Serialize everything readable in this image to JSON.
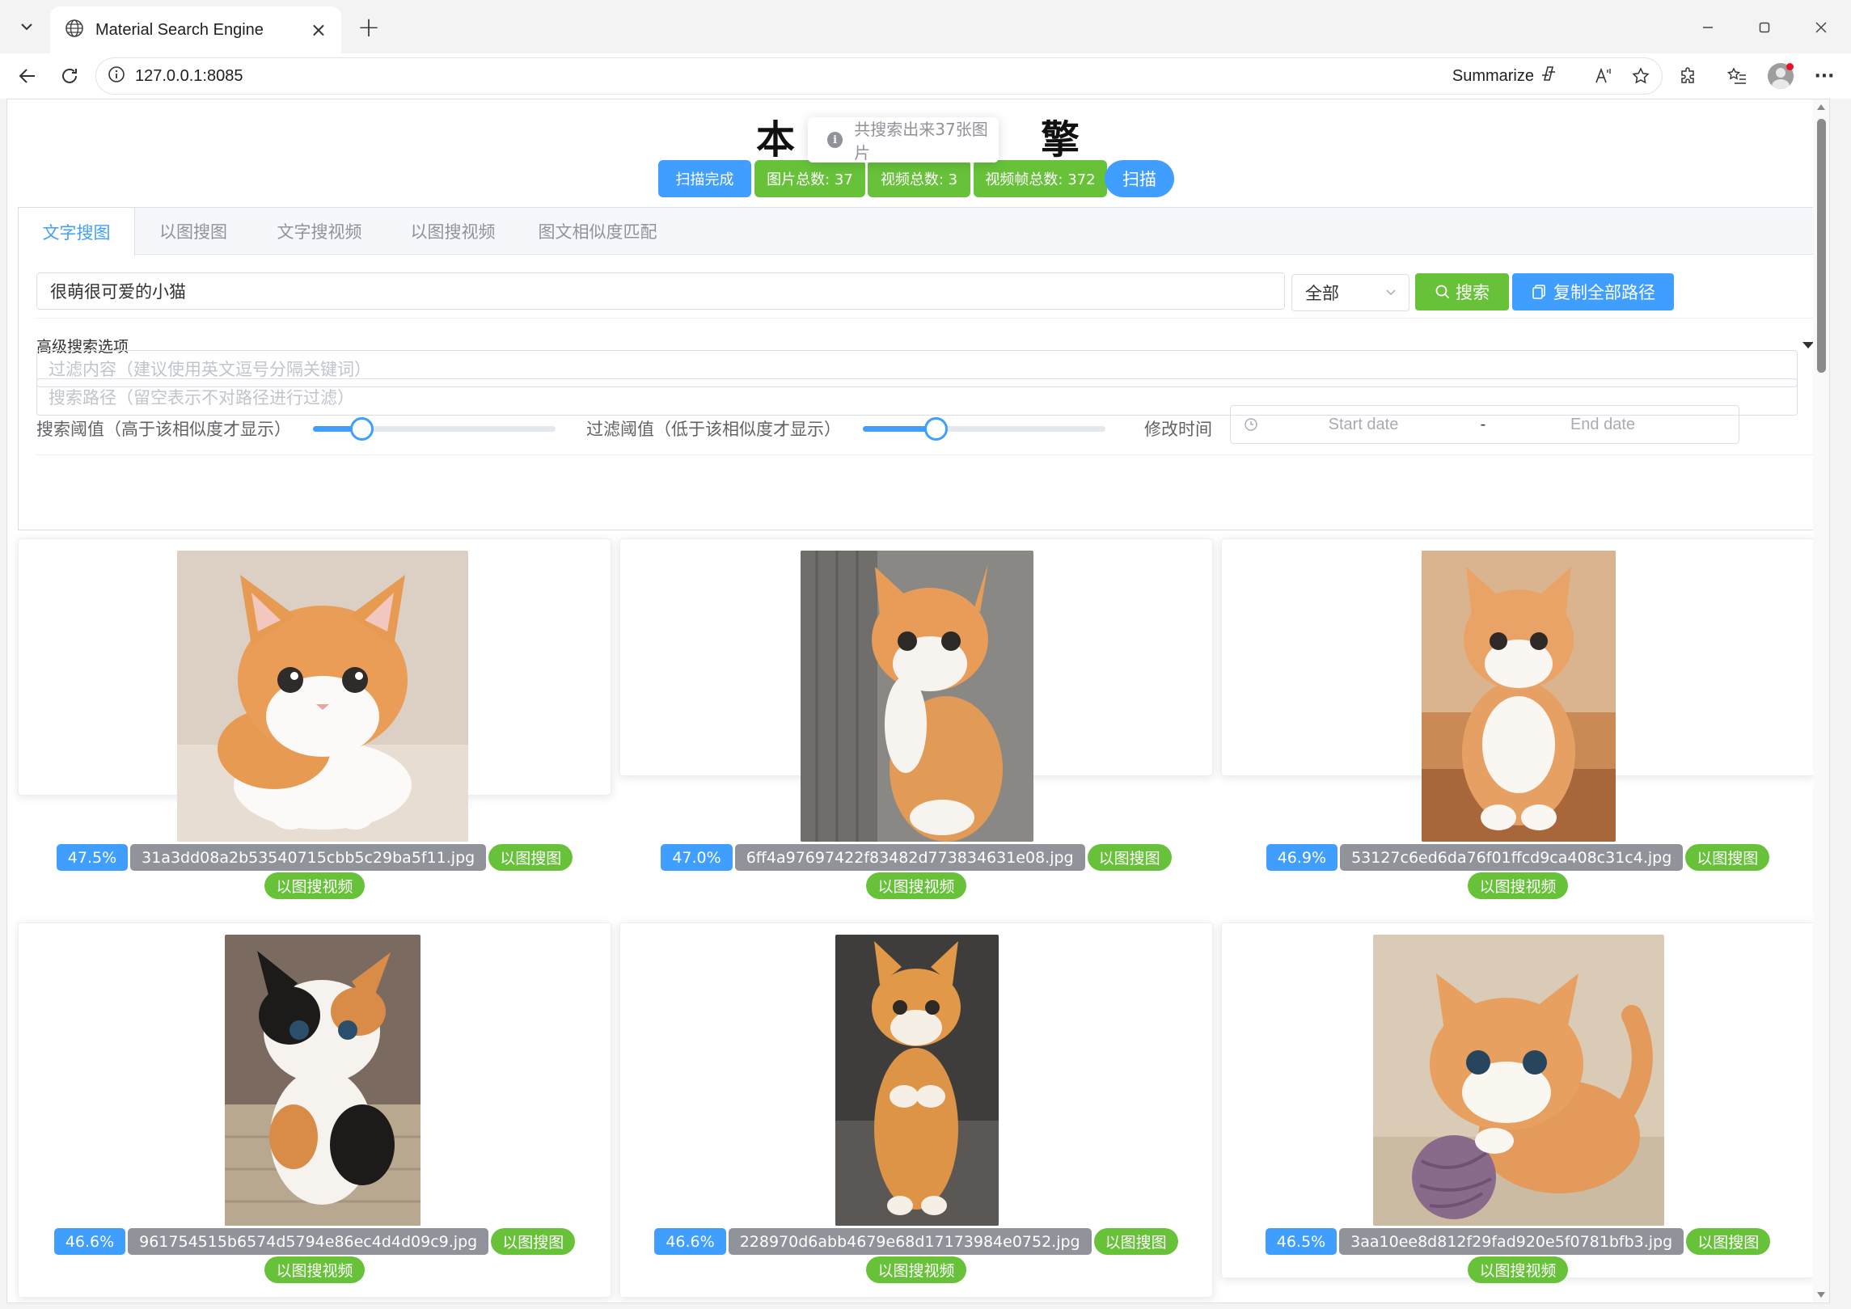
{
  "browser": {
    "tab_title": "Material Search Engine",
    "url": "127.0.0.1:8085",
    "summarize_label": "Summarize"
  },
  "page": {
    "title_left": "本",
    "title_right": "擎",
    "toast_text": "共搜索出来37张图片",
    "status_tags": [
      {
        "label": "扫描完成",
        "color": "#409eff"
      },
      {
        "label": "图片总数: 37",
        "color": "#67c23a"
      },
      {
        "label": "视频总数: 3",
        "color": "#67c23a"
      },
      {
        "label": "视频帧总数: 372",
        "color": "#67c23a"
      }
    ],
    "scan_button": "扫描"
  },
  "tabs": [
    {
      "label": "文字搜图",
      "active": true
    },
    {
      "label": "以图搜图",
      "active": false
    },
    {
      "label": "文字搜视频",
      "active": false
    },
    {
      "label": "以图搜视频",
      "active": false
    },
    {
      "label": "图文相似度匹配",
      "active": false
    }
  ],
  "search": {
    "query": "很萌很可爱的小猫",
    "scope": "全部",
    "search_button": "搜索",
    "copy_button": "复制全部路径"
  },
  "advanced": {
    "title": "高级搜索选项",
    "filter_placeholder": "过滤内容（建议使用英文逗号分隔关键词）",
    "path_placeholder": "搜索路径（留空表示不对路径进行过滤）",
    "search_threshold_label": "搜索阈值（高于该相似度才显示）",
    "search_threshold_level": 0.2,
    "filter_threshold_label": "过滤阈值（低于该相似度才显示）",
    "filter_threshold_level": 0.3,
    "modified_time_label": "修改时间",
    "start_placeholder": "Start date",
    "end_placeholder": "End date",
    "range_separator": "-"
  },
  "results": [
    {
      "score": "47.5%",
      "file": "31a3dd08a2b53540715cbb5c29ba5f11.jpg",
      "actions": [
        "以图搜图",
        "以图搜视频"
      ]
    },
    {
      "score": "47.0%",
      "file": "6ff4a97697422f83482d773834631e08.jpg",
      "actions": [
        "以图搜图",
        "以图搜视频"
      ]
    },
    {
      "score": "46.9%",
      "file": "53127c6ed6da76f01ffcd9ca408c31c4.jpg",
      "actions": [
        "以图搜图",
        "以图搜视频"
      ]
    },
    {
      "score": "46.6%",
      "file": "961754515b6574d5794e86ec4d4d09c9.jpg",
      "actions": [
        "以图搜图",
        "以图搜视频"
      ]
    },
    {
      "score": "46.6%",
      "file": "228970d6abb4679e68d17173984e0752.jpg",
      "actions": [
        "以图搜图",
        "以图搜视频"
      ]
    },
    {
      "score": "46.5%",
      "file": "3aa10ee8d812f29fad920e5f0781bfb3.jpg",
      "actions": [
        "以图搜图",
        "以图搜视频"
      ]
    }
  ]
}
